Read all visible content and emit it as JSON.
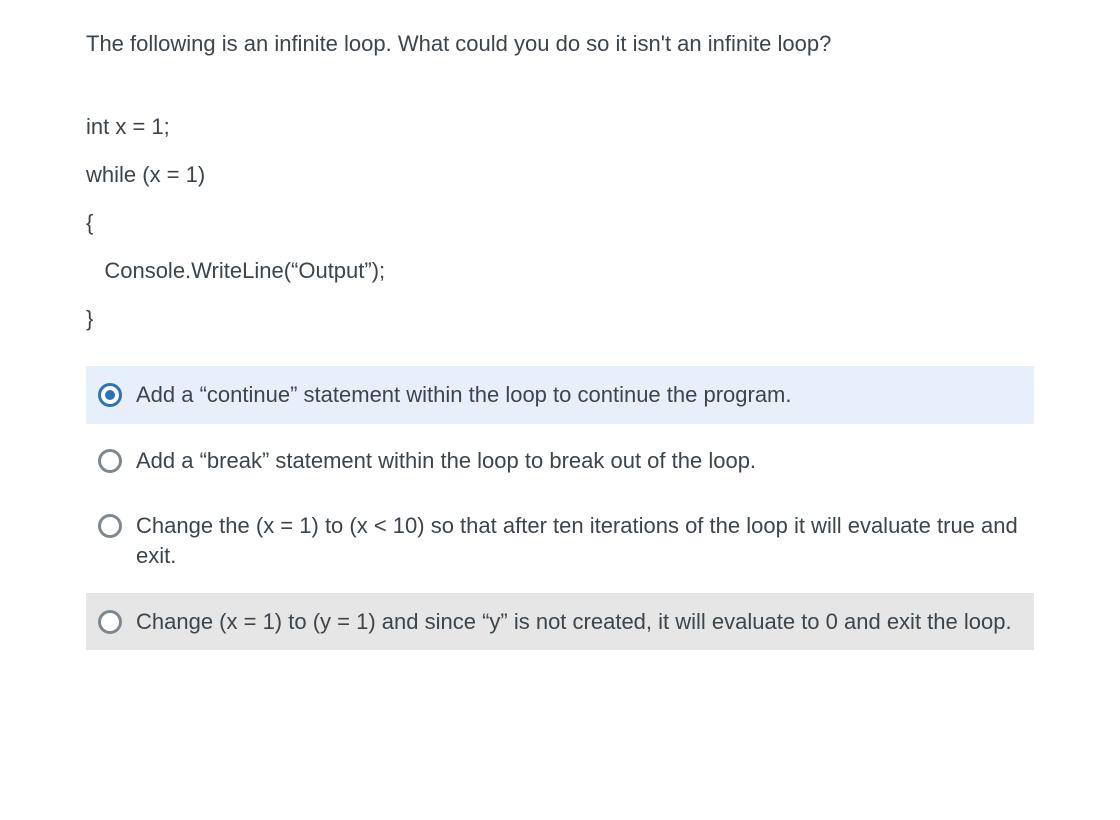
{
  "question": {
    "prompt": "The following is an infinite loop. What could you do so it isn't an infinite loop?",
    "code_lines": [
      "int x = 1;",
      "while (x = 1)",
      "{",
      "   Console.WriteLine(“Output”);",
      "}"
    ]
  },
  "options": [
    {
      "label": "Add a “continue” statement within the loop to continue the program.",
      "selected": true
    },
    {
      "label": "Add a “break” statement within the loop to break out of the loop.",
      "selected": false
    },
    {
      "label": "Change the (x = 1) to (x < 10) so that after ten iterations of the loop it will evaluate true and exit.",
      "selected": false
    },
    {
      "label": "Change (x = 1) to (y = 1) and since “y” is not created, it will evaluate to 0 and exit the loop.",
      "selected": false
    }
  ]
}
